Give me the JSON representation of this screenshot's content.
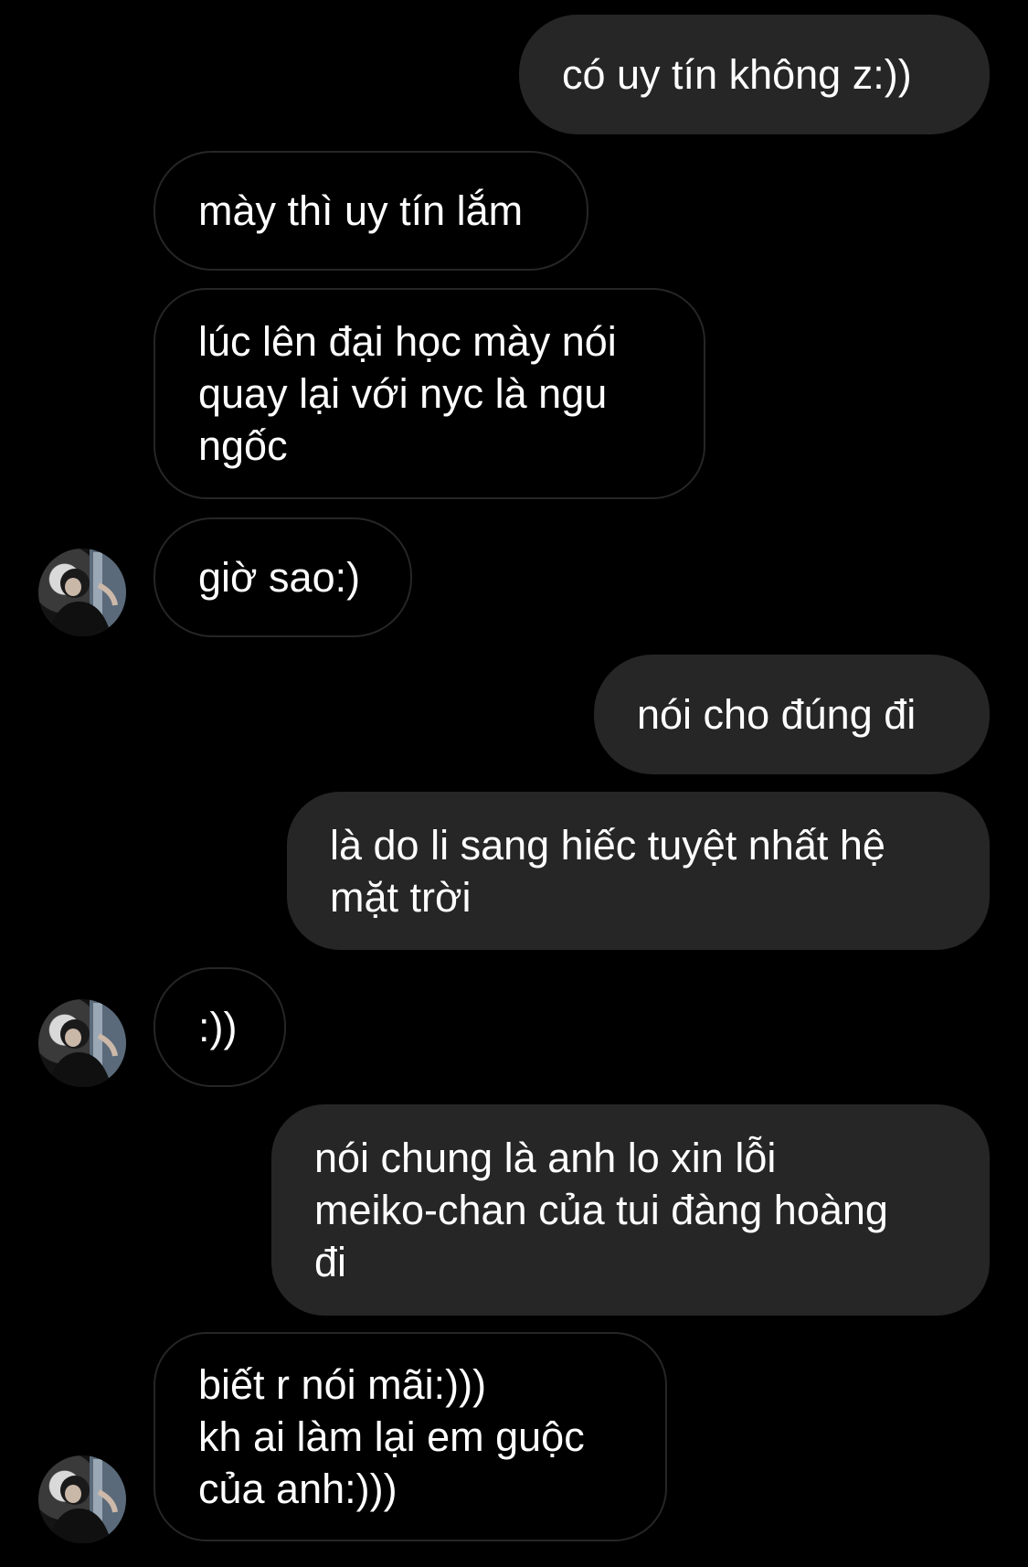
{
  "chat": {
    "messages": [
      {
        "side": "out",
        "text": "có uy tín không z:))"
      },
      {
        "side": "in",
        "text": "mày thì uy tín lắm"
      },
      {
        "side": "in",
        "text": "lúc lên đại học mày nói\nquay lại với nyc là ngu\nngốc"
      },
      {
        "side": "in",
        "text": "giờ sao:)"
      },
      {
        "side": "out",
        "text": "nói cho đúng đi"
      },
      {
        "side": "out",
        "text": "là do li sang hiếc tuyệt nhất hệ\nmặt trời"
      },
      {
        "side": "in",
        "text": ":))"
      },
      {
        "side": "out",
        "text": "nói chung là anh lo xin lỗi\nmeiko-chan của tui đàng hoàng\nđi"
      },
      {
        "side": "in",
        "text": "biết r nói mãi:)))\nkh ai làm lại em guộc\ncủa anh:)))"
      }
    ]
  },
  "colors": {
    "background": "#000000",
    "outgoing_bubble": "#262626",
    "incoming_border": "#262626",
    "text": "#ffffff"
  },
  "icons": {
    "avatar": "contact-avatar-photo"
  }
}
